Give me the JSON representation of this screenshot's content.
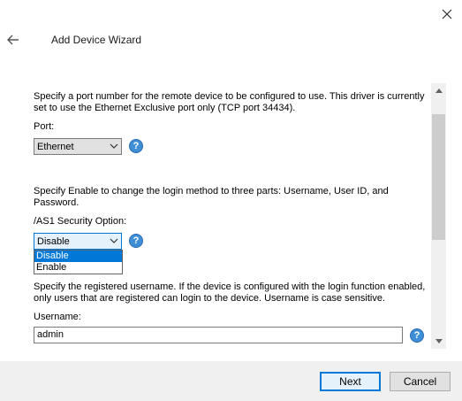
{
  "window": {
    "title": "Add Device Wizard"
  },
  "icons": {
    "close": "close-icon",
    "back": "back-arrow-icon",
    "help": "help-icon",
    "chevron": "chevron-down-icon"
  },
  "port_section": {
    "description": "Specify a port number for the remote device to be configured to use. This driver is currently set to use the Ethernet Exclusive port only (TCP port 34434).",
    "label": "Port:",
    "selected": "Ethernet",
    "help_glyph": "?"
  },
  "security_section": {
    "description": "Specify Enable to change the login method to three parts: Username, User ID, and Password.",
    "label": "/AS1 Security Option:",
    "selected": "Disable",
    "options": [
      "Disable",
      "Enable"
    ],
    "highlighted_option": "Disable",
    "help_glyph": "?"
  },
  "username_section": {
    "description": "Specify the registered username. If the device is configured with the login function enabled, only users that are registered can login to the device. Username is case sensitive.",
    "label": "Username:",
    "value": "admin",
    "help_glyph": "?"
  },
  "footer": {
    "next_label": "Next",
    "cancel_label": "Cancel"
  },
  "colors": {
    "accent": "#0078d7",
    "help": "#3f8fd6",
    "footer_bg": "#f0f0f0"
  }
}
